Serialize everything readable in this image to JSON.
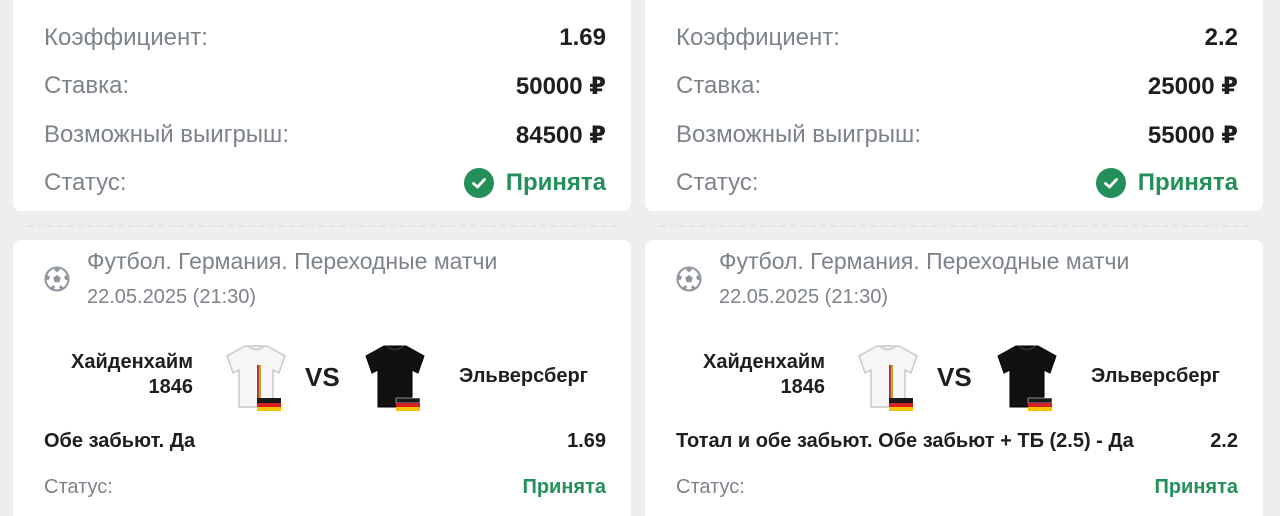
{
  "colors": {
    "background": "#eceef0",
    "card": "#ffffff",
    "label": "#7d838a",
    "value": "#1e1e1e",
    "accepted_green": "#23905a"
  },
  "icons": {
    "status": "check-circle-icon",
    "sport": "soccer-ball-icon",
    "flag": "germany-flag-icon"
  },
  "tickets": [
    {
      "summary": {
        "coef_label": "Коэффициент:",
        "coef_value": "1.69",
        "stake_label": "Ставка:",
        "stake_value": "50000 ₽",
        "win_label": "Возможный выигрыш:",
        "win_value": "84500 ₽",
        "status_label": "Статус:",
        "status_value": "Принята"
      },
      "event": {
        "league": "Футбол. Германия. Переходные матчи",
        "date": "22.05.2025 (21:30)",
        "home_team": "Хайденхайм\n1846",
        "vs": "VS",
        "away_team": "Эльверсберг",
        "market": "Обе забьют. Да",
        "odd": "1.69",
        "status_label": "Статус:",
        "status_value": "Принята"
      }
    },
    {
      "summary": {
        "coef_label": "Коэффициент:",
        "coef_value": "2.2",
        "stake_label": "Ставка:",
        "stake_value": "25000 ₽",
        "win_label": "Возможный выигрыш:",
        "win_value": "55000 ₽",
        "status_label": "Статус:",
        "status_value": "Принята"
      },
      "event": {
        "league": "Футбол. Германия. Переходные матчи",
        "date": "22.05.2025 (21:30)",
        "home_team": "Хайденхайм\n1846",
        "vs": "VS",
        "away_team": "Эльверсберг",
        "market": "Тотал и обе забьют. Обе забьют + ТБ (2.5) - Да",
        "odd": "2.2",
        "status_label": "Статус:",
        "status_value": "Принята"
      }
    }
  ]
}
